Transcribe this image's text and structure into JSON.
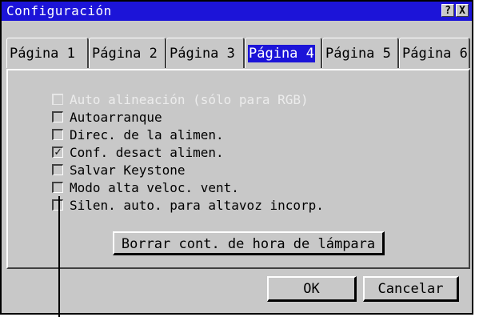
{
  "window": {
    "title": "Configuración",
    "help_glyph": "?",
    "close_glyph": "X"
  },
  "tabs": [
    {
      "label": "Página 1",
      "active": false
    },
    {
      "label": "Página 2",
      "active": false
    },
    {
      "label": "Página 3",
      "active": false
    },
    {
      "label": "Página 4",
      "active": true
    },
    {
      "label": "Página 5",
      "active": false
    },
    {
      "label": "Página 6",
      "active": false
    }
  ],
  "options": [
    {
      "label": "Auto alineación (sólo para RGB)",
      "checked": false,
      "enabled": false
    },
    {
      "label": "Autoarranque",
      "checked": false,
      "enabled": true
    },
    {
      "label": "Direc. de la alimen.",
      "checked": false,
      "enabled": true
    },
    {
      "label": "Conf. desact alimen.",
      "checked": true,
      "enabled": true
    },
    {
      "label": "Salvar Keystone",
      "checked": false,
      "enabled": true
    },
    {
      "label": "Modo alta veloc. vent.",
      "checked": false,
      "enabled": true
    },
    {
      "label": "Silen. auto. para altavoz incorp.",
      "checked": false,
      "enabled": true
    }
  ],
  "check_glyph": "✓",
  "lamp_button": "Borrar cont. de hora de lámpara",
  "footer": {
    "ok": "OK",
    "cancel": "Cancelar"
  },
  "colors": {
    "title_bar": "#1c14d8",
    "face": "#c8c8c8"
  }
}
